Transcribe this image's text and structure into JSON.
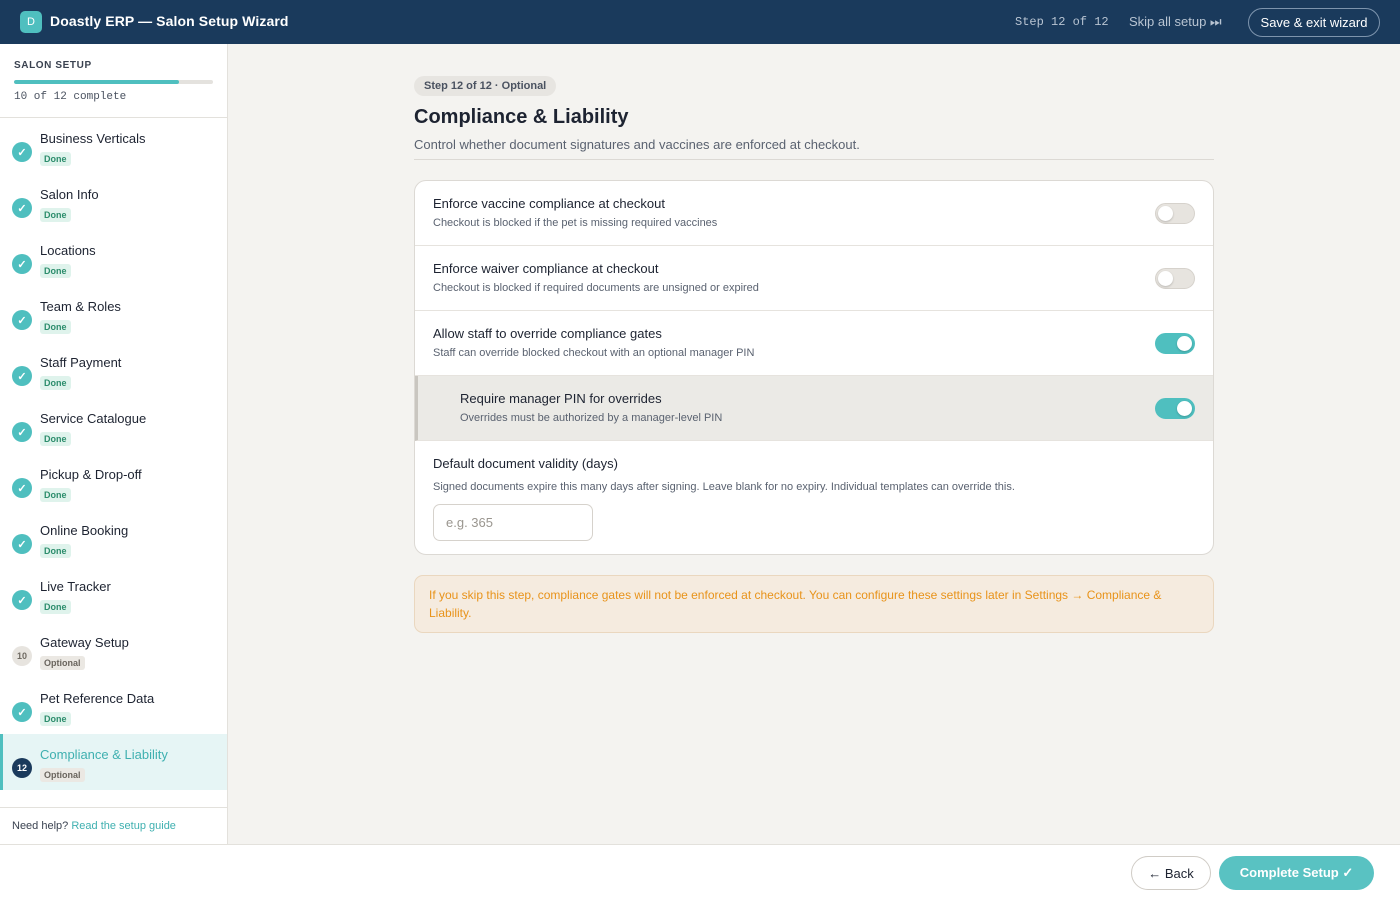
{
  "header": {
    "logo_letter": "D",
    "title": "Doastly ERP — Salon Setup Wizard",
    "step_count": "Step 12 of 12",
    "skip_label": "Skip all setup ⏭",
    "save_exit_label": "Save & exit wizard"
  },
  "sidebar": {
    "title": "SALON SETUP",
    "progress_percent": 83,
    "complete_text": "10 of 12 complete",
    "items": [
      {
        "label": "Business Verticals",
        "badge": "Done",
        "status": "done",
        "icon": "check-icon"
      },
      {
        "label": "Salon Info",
        "badge": "Done",
        "status": "done",
        "icon": "check-icon"
      },
      {
        "label": "Locations",
        "badge": "Done",
        "status": "done",
        "icon": "check-icon"
      },
      {
        "label": "Team & Roles",
        "badge": "Done",
        "status": "done",
        "icon": "check-icon"
      },
      {
        "label": "Staff Payment",
        "badge": "Done",
        "status": "done",
        "icon": "check-icon"
      },
      {
        "label": "Service Catalogue",
        "badge": "Done",
        "status": "done",
        "icon": "check-icon"
      },
      {
        "label": "Pickup & Drop-off",
        "badge": "Done",
        "status": "done",
        "icon": "check-icon"
      },
      {
        "label": "Online Booking",
        "badge": "Done",
        "status": "done",
        "icon": "check-icon"
      },
      {
        "label": "Live Tracker",
        "badge": "Done",
        "status": "done",
        "icon": "check-icon"
      },
      {
        "label": "Gateway Setup",
        "badge": "Optional",
        "status": "optional",
        "number": "10"
      },
      {
        "label": "Pet Reference Data",
        "badge": "Done",
        "status": "done",
        "icon": "check-icon"
      },
      {
        "label": "Compliance & Liability",
        "badge": "Optional",
        "status": "current",
        "number": "12"
      }
    ],
    "help_prefix": "Need help?",
    "help_link": "Read the setup guide"
  },
  "main": {
    "step_pill": "Step 12 of 12 · Optional",
    "title": "Compliance & Liability",
    "subtitle": "Control whether document signatures and vaccines are enforced at checkout.",
    "settings": [
      {
        "title": "Enforce vaccine compliance at checkout",
        "desc": "Checkout is blocked if the pet is missing required vaccines",
        "on": false,
        "nested": false
      },
      {
        "title": "Enforce waiver compliance at checkout",
        "desc": "Checkout is blocked if required documents are unsigned or expired",
        "on": false,
        "nested": false
      },
      {
        "title": "Allow staff to override compliance gates",
        "desc": "Staff can override blocked checkout with an optional manager PIN",
        "on": true,
        "nested": false
      },
      {
        "title": "Require manager PIN for overrides",
        "desc": "Overrides must be authorized by a manager-level PIN",
        "on": true,
        "nested": true
      }
    ],
    "validity": {
      "title": "Default document validity (days)",
      "desc": "Signed documents expire this many days after signing. Leave blank for no expiry. Individual templates can override this.",
      "value": "",
      "placeholder": "e.g. 365"
    },
    "notice": "If you skip this step, compliance gates will not be enforced at checkout. You can configure these settings later in Settings → Compliance & Liability."
  },
  "footer": {
    "back_label": "← Back",
    "complete_label": "Complete Setup ✓"
  },
  "colors": {
    "header_bg": "#1a3a5c",
    "accent": "#4fbfbf",
    "warning_text": "#e8931a",
    "warning_bg": "#f5ebdf"
  }
}
